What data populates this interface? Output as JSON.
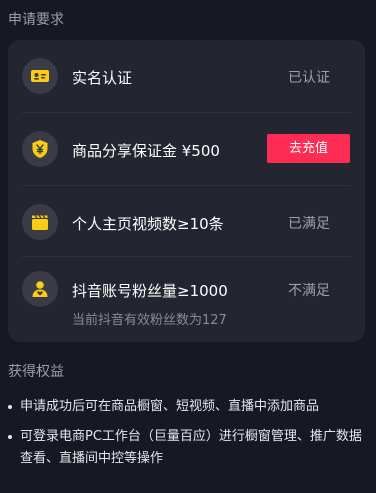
{
  "sections": {
    "requirements_title": "申请要求",
    "benefits_title": "获得权益"
  },
  "requirements": [
    {
      "icon": "id-card-icon",
      "label": "实名认证",
      "status": "已认证"
    },
    {
      "icon": "shield-yen-icon",
      "label": "商品分享保证金 ¥500",
      "action": "去充值"
    },
    {
      "icon": "video-clapper-icon",
      "label": "个人主页视频数≥10条",
      "status": "已满足"
    },
    {
      "icon": "fans-icon",
      "label": "抖音账号粉丝量≥1000",
      "status": "不满足",
      "sub": "当前抖音有效粉丝数为127"
    }
  ],
  "benefits": [
    "申请成功后可在商品橱窗、短视频、直播中添加商品",
    "可登录电商PC工作台（巨量百应）进行橱窗管理、推广数据查看、直播间中控等操作"
  ],
  "colors": {
    "background": "#161823",
    "card": "#232530",
    "accent": "#fe2c55",
    "icon_yellow": "#facc15"
  }
}
